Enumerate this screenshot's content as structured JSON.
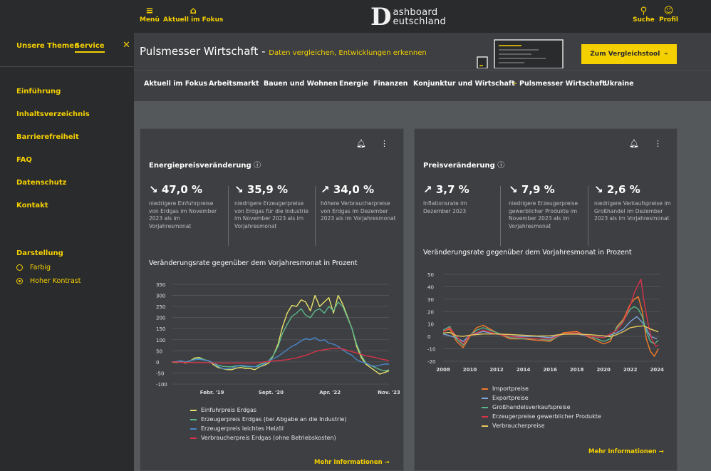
{
  "topbar": {
    "menu_label": "Menü",
    "focus_label": "Aktuell im Fokus",
    "brand_letter": "D",
    "brand_line1": "ashboard",
    "brand_line2": "eutschland",
    "search_label": "Suche",
    "profile_label": "Profil"
  },
  "sidebar": {
    "tab_topics": "Unsere Themen",
    "tab_service": "Service",
    "close": "✕",
    "links": [
      "Einführung",
      "Inhaltsverzeichnis",
      "Barrierefreiheit",
      "FAQ",
      "Datenschutz",
      "Kontakt"
    ],
    "display_heading": "Darstellung",
    "option_color": "Farbig",
    "option_contrast": "Hoher Kontrast"
  },
  "banner": {
    "title": "Pulsmesser Wirtschaft",
    "dash": " - ",
    "subtitle": "Daten vergleichen, Entwicklungen erkennen",
    "compare_button": "Zum Vergleichstool"
  },
  "nav": {
    "items": [
      "Aktuell im Fokus",
      "Arbeitsmarkt",
      "Bauen und Wohnen",
      "Energie",
      "Finanzen",
      "Konjunktur und Wirtschaft",
      "Pulsmesser Wirtschaft",
      "Ukraine"
    ]
  },
  "energy": {
    "title": "Energiepreisveränderung",
    "kpis": [
      {
        "arrow": "↘",
        "value": "47,0 %",
        "desc": "niedrigere Einfuhrpreise von Erdgas im November 2023 als im Vorjahresmonat"
      },
      {
        "arrow": "↘",
        "value": "35,9 %",
        "desc": "niedrigere Erzeugerpreise von Erdgas für die Industrie im November 2023 als im Vorjahresmonat"
      },
      {
        "arrow": "↗",
        "value": "34,0 %",
        "desc": "höhere Verbraucherpreise von Erdgas im Dezember 2023 als im Vorjahresmonat"
      }
    ],
    "chart_title": "Veränderungsrate gegenüber dem Vorjahresmonat in Prozent",
    "more": "Mehr Informationen →"
  },
  "price": {
    "title": "Preisveränderung",
    "kpis": [
      {
        "arrow": "↗",
        "value": "3,7 %",
        "desc": "Inflationsrate im Dezember 2023"
      },
      {
        "arrow": "↘",
        "value": "7,9 %",
        "desc": "niedrigere Erzeugerpreise gewerblicher Produkte im November 2023 als im Vorjahresmonat"
      },
      {
        "arrow": "↘",
        "value": "2,6 %",
        "desc": "niedrigere Verkaufspreise im Großhandel im Dezember 2023 als im Vorjahresmonat"
      }
    ],
    "chart_title": "Veränderungsrate gegenüber dem Vorjahresmonat in Prozent",
    "more": "Mehr Informationen →"
  },
  "icons": {
    "menu": "hamburger-icon",
    "home": "home-icon",
    "search": "search-icon",
    "profile": "profile-icon",
    "bell": "bell-icon",
    "more": "kebab-icon",
    "info": "info-icon",
    "pulse": "pulse-icon"
  },
  "colors": {
    "accent": "#f5d000",
    "background": "#55585b",
    "panel": "#3d3f42",
    "sidebar": "#2a2b2d"
  },
  "chart_data": [
    {
      "type": "line",
      "title": "Veränderungsrate gegenüber dem Vorjahresmonat in Prozent",
      "x_ticks": [
        "Febr. '19",
        "Sept. '20",
        "Apr. '22",
        "Nov. '23"
      ],
      "x_tick_pos": [
        13,
        32,
        51,
        70
      ],
      "x_range": [
        0,
        70
      ],
      "ylim": [
        -100,
        350
      ],
      "y_ticks": [
        350,
        300,
        250,
        200,
        150,
        100,
        50,
        0,
        -50,
        -100
      ],
      "grid": true,
      "legend_position": "bottom",
      "series": [
        {
          "name": "Einfuhrpreis Erdgas",
          "color": "#e8e26a",
          "values": [
            0,
            -2,
            2,
            -5,
            5,
            18,
            20,
            10,
            5,
            -12,
            -25,
            -30,
            -35,
            -35,
            -28,
            -25,
            -30,
            -30,
            -35,
            -22,
            -15,
            -5,
            30,
            80,
            160,
            220,
            255,
            250,
            280,
            270,
            230,
            300,
            250,
            270,
            290,
            220,
            300,
            260,
            205,
            150,
            70,
            20,
            -10,
            -25,
            -40,
            -55,
            -48,
            -40
          ]
        },
        {
          "name": "Erzeugerpreis Erdgas (bei Abgabe an die Industrie)",
          "color": "#5cb88a",
          "values": [
            0,
            0,
            2,
            0,
            5,
            12,
            15,
            10,
            5,
            -5,
            -15,
            -20,
            -22,
            -22,
            -18,
            -18,
            -22,
            -22,
            -22,
            -12,
            -5,
            5,
            30,
            70,
            130,
            170,
            205,
            220,
            240,
            210,
            200,
            230,
            240,
            220,
            250,
            230,
            270,
            250,
            200,
            150,
            80,
            30,
            -5,
            -15,
            -25,
            -35,
            -40,
            -36
          ]
        },
        {
          "name": "Erzeugerpreis leichtes Heizöl",
          "color": "#4a86c8",
          "values": [
            0,
            2,
            5,
            0,
            5,
            10,
            12,
            8,
            5,
            -5,
            -20,
            -30,
            -32,
            -28,
            -20,
            -15,
            -18,
            -20,
            -22,
            -20,
            -10,
            5,
            15,
            25,
            40,
            55,
            70,
            80,
            95,
            105,
            100,
            110,
            95,
            100,
            85,
            80,
            70,
            55,
            40,
            30,
            10,
            0,
            -5,
            -15,
            -20,
            -15,
            -10,
            -10
          ]
        },
        {
          "name": "Verbraucherpreis Erdgas (ohne Betriebskosten)",
          "color": "#d8324a",
          "values": [
            0,
            0,
            -2,
            -2,
            -3,
            -3,
            -4,
            -4,
            -4,
            -5,
            -5,
            -5,
            -5,
            -5,
            -5,
            -5,
            -5,
            -5,
            -5,
            -3,
            0,
            2,
            4,
            6,
            8,
            10,
            14,
            18,
            24,
            30,
            38,
            46,
            52,
            55,
            58,
            60,
            62,
            58,
            52,
            46,
            40,
            34,
            28,
            24,
            20,
            14,
            10,
            6
          ]
        }
      ]
    },
    {
      "type": "line",
      "title": "Veränderungsrate gegenüber dem Vorjahresmonat in Prozent",
      "x_ticks": [
        "2008",
        "2010",
        "2012",
        "2014",
        "2016",
        "2018",
        "2020",
        "2022",
        "2024"
      ],
      "x_tick_pos": [
        2008,
        2010,
        2012,
        2014,
        2016,
        2018,
        2020,
        2022,
        2024
      ],
      "x_range": [
        2008,
        2024.2
      ],
      "ylim": [
        -20,
        50
      ],
      "y_ticks": [
        50,
        40,
        30,
        20,
        10,
        0,
        -10,
        -20
      ],
      "grid": true,
      "legend_position": "bottom",
      "series": [
        {
          "name": "Importpreise",
          "color": "#f47a2b",
          "x": [
            2008,
            2008.5,
            2009,
            2009.5,
            2010,
            2010.5,
            2011,
            2012,
            2013,
            2014,
            2015,
            2016,
            2017,
            2018,
            2019,
            2020,
            2020.5,
            2021,
            2021.5,
            2022,
            2022.3,
            2022.6,
            2022.9,
            2023.2,
            2023.5,
            2023.8,
            2024.1
          ],
          "values": [
            4,
            6,
            -4,
            -9,
            0,
            7,
            9,
            3,
            -2,
            -2,
            -3,
            -4,
            3,
            4,
            -1,
            -6,
            -4,
            8,
            14,
            26,
            30,
            32,
            20,
            -2,
            -12,
            -16,
            -10
          ]
        },
        {
          "name": "Exportpreise",
          "color": "#7fa7e0",
          "x": [
            2008,
            2009,
            2009.5,
            2010,
            2011,
            2012,
            2013,
            2014,
            2015,
            2016,
            2017,
            2018,
            2019,
            2020,
            2021,
            2021.5,
            2022,
            2022.5,
            2023,
            2023.5,
            2024
          ],
          "values": [
            2,
            -1,
            -4,
            1,
            4,
            2,
            0,
            0,
            0,
            -1,
            2,
            2,
            0,
            -1,
            3,
            6,
            12,
            16,
            10,
            0,
            -2
          ]
        },
        {
          "name": "Großhandelsverkaufspreise",
          "color": "#5cb88a",
          "x": [
            2008,
            2008.5,
            2009,
            2009.5,
            2010,
            2010.5,
            2011,
            2012,
            2013,
            2014,
            2015,
            2016,
            2017,
            2018,
            2019,
            2020,
            2020.5,
            2021,
            2021.5,
            2022,
            2022.3,
            2022.6,
            2022.9,
            2023.2,
            2023.5,
            2023.8,
            2024.1
          ],
          "values": [
            5,
            8,
            -2,
            -7,
            1,
            5,
            7,
            3,
            -1,
            -2,
            -2,
            -3,
            2,
            3,
            0,
            -4,
            -2,
            7,
            13,
            22,
            24,
            22,
            16,
            4,
            -4,
            -6,
            -3
          ]
        },
        {
          "name": "Erzeugerpreise gewerblicher Produkte",
          "color": "#d8324a",
          "x": [
            2008,
            2008.5,
            2009,
            2009.5,
            2010,
            2011,
            2012,
            2013,
            2014,
            2015,
            2016,
            2017,
            2018,
            2019,
            2020,
            2021,
            2021.5,
            2022,
            2022.3,
            2022.6,
            2022.8,
            2023,
            2023.3,
            2023.6,
            2023.9,
            2024.1
          ],
          "values": [
            4,
            7,
            0,
            -6,
            1,
            5,
            2,
            0,
            -1,
            -2,
            -2,
            2,
            3,
            0,
            -1,
            5,
            12,
            25,
            35,
            42,
            46,
            30,
            12,
            -2,
            -8,
            -7
          ]
        },
        {
          "name": "Verbraucherpreise",
          "color": "#e8c85a",
          "x": [
            2008,
            2008.5,
            2009,
            2009.5,
            2010,
            2011,
            2012,
            2013,
            2014,
            2015,
            2016,
            2017,
            2018,
            2019,
            2020,
            2020.5,
            2021,
            2021.5,
            2022,
            2022.5,
            2023,
            2023.5,
            2024.1
          ],
          "values": [
            2.8,
            3.2,
            0.5,
            0,
            1,
            2,
            2,
            1.5,
            1,
            0.3,
            0.5,
            1.8,
            1.9,
            1.4,
            0.5,
            -0.2,
            1.5,
            4,
            7,
            8,
            8.5,
            6,
            3.7
          ]
        }
      ]
    }
  ]
}
